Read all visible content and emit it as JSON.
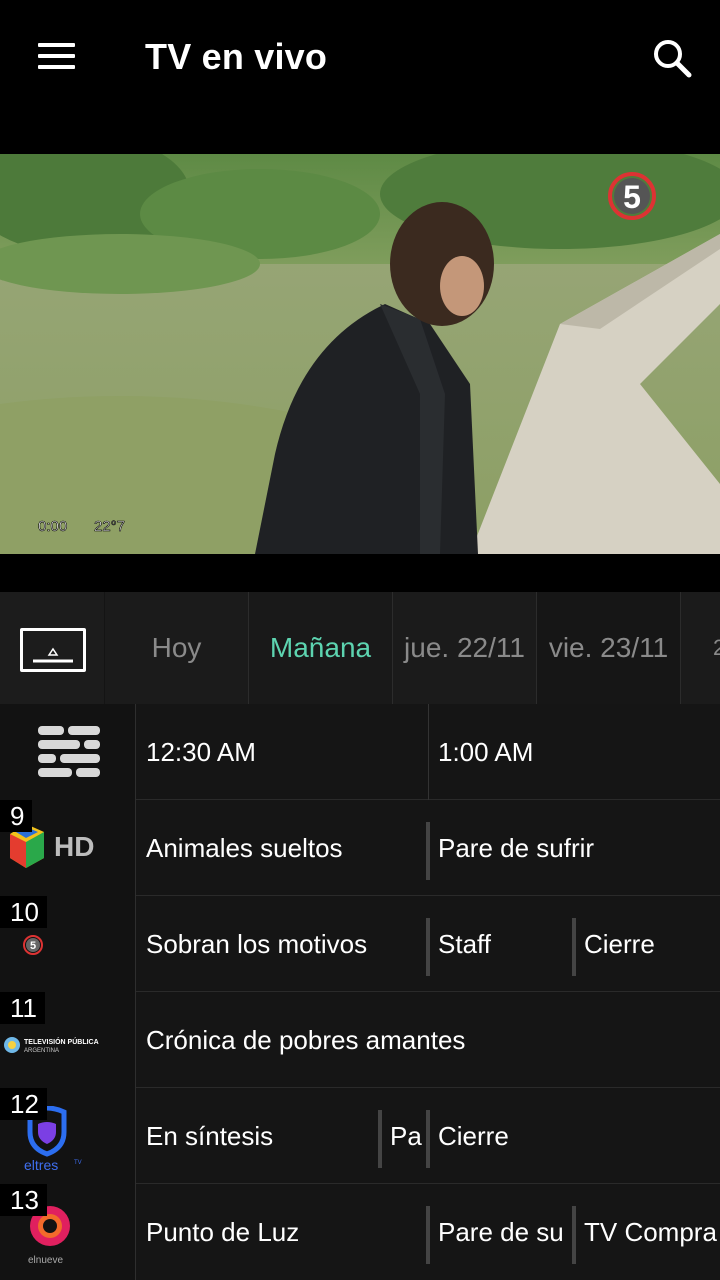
{
  "app": {
    "title": "TV en vivo",
    "menu_icon": "hamburger-menu-icon",
    "search_icon": "search-icon"
  },
  "player": {
    "channel_bug": "5",
    "osd_time": "0:00",
    "osd_temp": "22°7"
  },
  "tabs": {
    "tv_icon": "tv-screen-icon",
    "items": [
      {
        "label": "Hoy"
      },
      {
        "label": "Mañana"
      },
      {
        "label": "jue. 22/11"
      },
      {
        "label": "vie. 23/11"
      },
      {
        "label": "2"
      }
    ],
    "active_index": 1,
    "accent_color": "#5dd4b0"
  },
  "guide": {
    "header_icon": "grid-list-icon",
    "times": [
      "12:30 AM",
      "1:00 AM"
    ],
    "channels": [
      {
        "number": "9",
        "logo": "canal-9-hd-logo",
        "logo_text": "HD",
        "programs": [
          {
            "title": "Animales sueltos"
          },
          {
            "title": "Pare de sufrir"
          }
        ]
      },
      {
        "number": "10",
        "logo": "telefe-5-logo",
        "logo_text": "5",
        "programs": [
          {
            "title": "Sobran los motivos"
          },
          {
            "title": "Staff"
          },
          {
            "title": "Cierre"
          }
        ]
      },
      {
        "number": "11",
        "logo": "television-publica-logo",
        "logo_text": "TELEVISIÓN PÚBLICA",
        "logo_subtext": "ARGENTINA",
        "programs": [
          {
            "title": "Crónica de pobres amantes"
          }
        ]
      },
      {
        "number": "12",
        "logo": "eltres-tv-logo",
        "logo_text": "eltres",
        "logo_subtext": "TV",
        "programs": [
          {
            "title": "En síntesis"
          },
          {
            "title": "Pa"
          },
          {
            "title": "Cierre"
          }
        ]
      },
      {
        "number": "13",
        "logo": "elnueve-logo",
        "logo_text": "elnueve",
        "programs": [
          {
            "title": "Punto de Luz"
          },
          {
            "title": "Pare de su"
          },
          {
            "title": "TV Compra"
          }
        ]
      }
    ]
  }
}
